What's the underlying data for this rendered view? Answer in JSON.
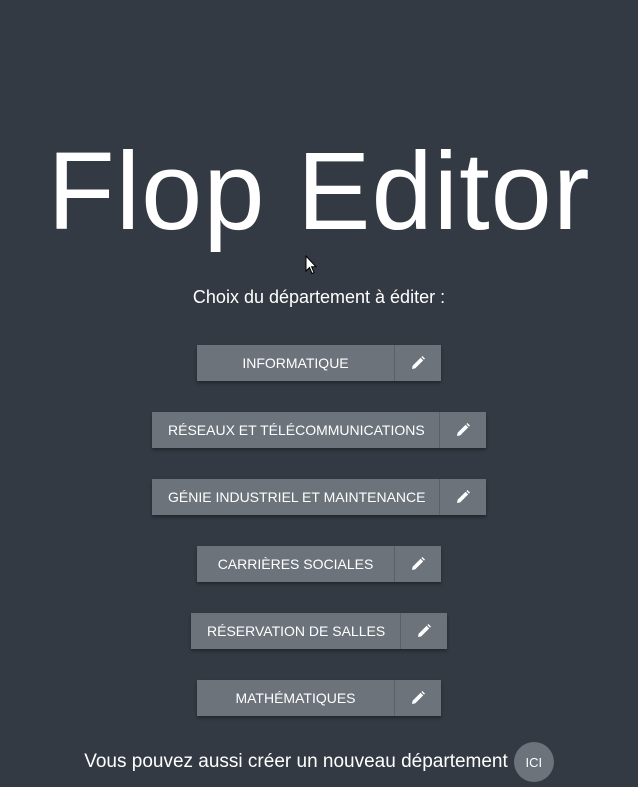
{
  "app": {
    "title": "Flop Editor",
    "subtitle": "Choix du département à éditer :"
  },
  "departments": [
    {
      "label": "INFORMATIQUE",
      "edit_icon": "pencil-icon"
    },
    {
      "label": "RÉSEAUX ET TÉLÉCOMMUNICATIONS",
      "edit_icon": "pencil-icon"
    },
    {
      "label": "GÉNIE INDUSTRIEL ET MAINTENANCE",
      "edit_icon": "pencil-icon"
    },
    {
      "label": "CARRIÈRES SOCIALES",
      "edit_icon": "pencil-icon"
    },
    {
      "label": "RÉSERVATION DE SALLES",
      "edit_icon": "pencil-icon"
    },
    {
      "label": "MATHÉMATIQUES",
      "edit_icon": "pencil-icon"
    }
  ],
  "footer": {
    "text": "Vous pouvez aussi créer un nouveau département",
    "button_label": "ICI"
  },
  "colors": {
    "background": "#343a43",
    "button": "#6c737b",
    "text": "#ffffff"
  }
}
